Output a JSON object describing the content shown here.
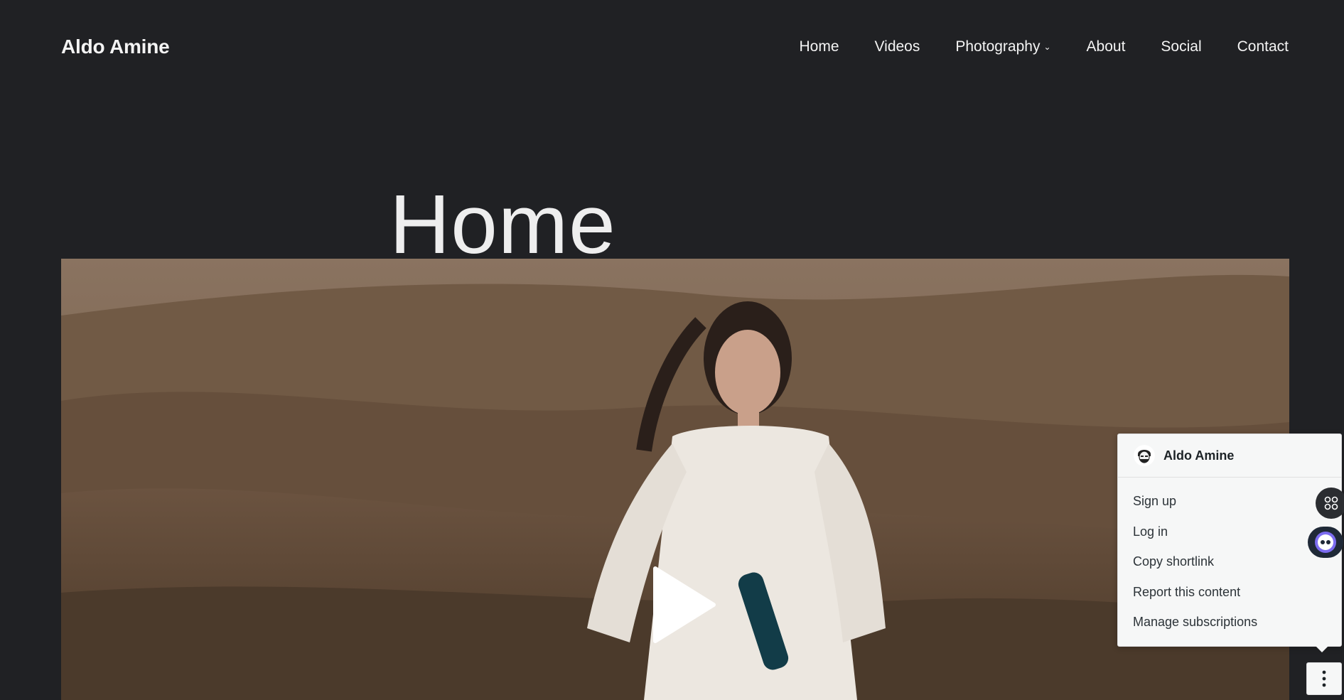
{
  "site": {
    "title": "Aldo Amine"
  },
  "nav": {
    "items": [
      {
        "label": "Home"
      },
      {
        "label": "Videos"
      },
      {
        "label": "Photography"
      },
      {
        "label": "About"
      },
      {
        "label": "Social"
      },
      {
        "label": "Contact"
      }
    ]
  },
  "page": {
    "title": "Home"
  },
  "popup": {
    "name": "Aldo Amine",
    "items": [
      {
        "label": "Sign up"
      },
      {
        "label": "Log in"
      },
      {
        "label": "Copy shortlink"
      },
      {
        "label": "Report this content"
      },
      {
        "label": "Manage subscriptions"
      }
    ]
  },
  "icons": {
    "play": "play-icon",
    "more": "more-vertical-icon",
    "grid": "grid-icon",
    "chat": "chat-bot-icon",
    "dropdown": "chevron-down-icon",
    "avatar": "avatar"
  },
  "colors": {
    "background": "#202124",
    "text": "#ffffff",
    "popup_bg": "#f6f7f7"
  }
}
